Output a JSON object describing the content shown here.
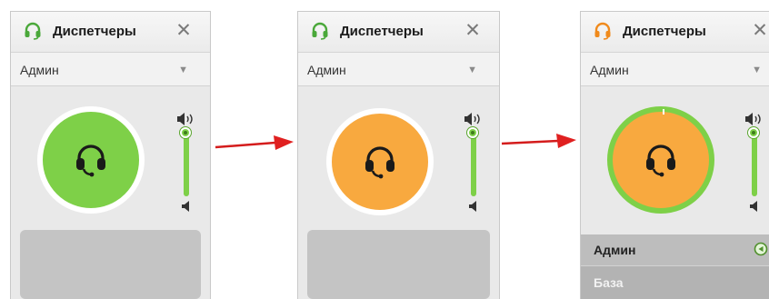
{
  "panels": [
    {
      "title": "Диспетчеры",
      "selected_operator": "Админ",
      "status_color": "#7ed048",
      "header_icon_color": "#4aa83a",
      "volume_level": 1.0
    },
    {
      "title": "Диспетчеры",
      "selected_operator": "Админ",
      "status_color": "#f8a93f",
      "header_icon_color": "#4aa83a",
      "volume_level": 1.0
    },
    {
      "title": "Диспетчеры",
      "selected_operator": "Админ",
      "status_color": "#f8a93f",
      "ring_color": "#7ed048",
      "header_icon_color": "#f08a1c",
      "volume_level": 1.0,
      "list": [
        {
          "label": "Админ",
          "icon": "play-circle-icon"
        },
        {
          "label": "База"
        }
      ]
    }
  ],
  "icons": {
    "header": "headset-icon",
    "close": "close-icon",
    "dropdown": "chevron-down-icon",
    "status": "headset-icon",
    "volume_high": "speaker-high-icon",
    "volume_low": "speaker-low-icon"
  },
  "arrow_color": "#e02020"
}
